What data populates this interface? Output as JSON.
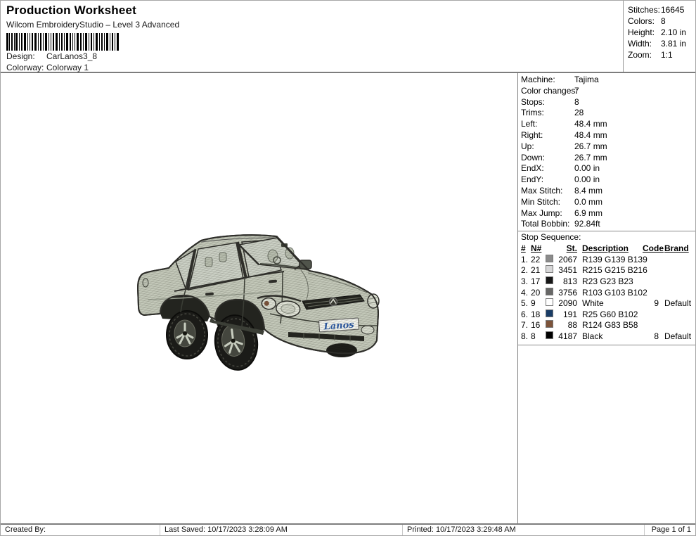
{
  "header": {
    "title": "Production Worksheet",
    "subtitle": "Wilcom EmbroideryStudio – Level 3 Advanced",
    "design_label": "Design:",
    "design_value": "CarLanos3_8",
    "colorway_label": "Colorway:",
    "colorway_value": "Colorway 1"
  },
  "stats": {
    "rows": [
      {
        "label": "Stitches:",
        "value": "16645"
      },
      {
        "label": "Colors:",
        "value": "8"
      },
      {
        "label": "Height:",
        "value": "2.10 in"
      },
      {
        "label": "Width:",
        "value": "3.81 in"
      },
      {
        "label": "Zoom:",
        "value": "1:1"
      }
    ]
  },
  "machine": {
    "rows": [
      {
        "label": "Machine:",
        "value": "Tajima"
      },
      {
        "label": "Color changes:",
        "value": "7"
      },
      {
        "label": "Stops:",
        "value": "8"
      },
      {
        "label": "Trims:",
        "value": "28"
      },
      {
        "label": "Left:",
        "value": "48.4 mm"
      },
      {
        "label": "Right:",
        "value": "48.4 mm"
      },
      {
        "label": "Up:",
        "value": "26.7 mm"
      },
      {
        "label": "Down:",
        "value": "26.7 mm"
      },
      {
        "label": "EndX:",
        "value": "0.00 in"
      },
      {
        "label": "EndY:",
        "value": "0.00 in"
      },
      {
        "label": "Max Stitch:",
        "value": "8.4 mm"
      },
      {
        "label": "Min Stitch:",
        "value": "0.0 mm"
      },
      {
        "label": "Max Jump:",
        "value": "6.9 mm"
      },
      {
        "label": "Total Bobbin:",
        "value": "92.84ft"
      }
    ]
  },
  "stop_sequence": {
    "section_label": "Stop Sequence:",
    "headers": {
      "num": "#",
      "n": "N#",
      "st": "St.",
      "desc": "Description",
      "code": "Code",
      "brand": "Brand"
    },
    "rows": [
      {
        "num": "1.",
        "n": "22",
        "color": "#8b8b8b",
        "st": "2067",
        "desc": "R139 G139 B139",
        "code": "",
        "brand": ""
      },
      {
        "num": "2.",
        "n": "21",
        "color": "#d7d7d8",
        "st": "3451",
        "desc": "R215 G215 B216",
        "code": "",
        "brand": ""
      },
      {
        "num": "3.",
        "n": "17",
        "color": "#171717",
        "st": "813",
        "desc": "R23 G23 B23",
        "code": "",
        "brand": ""
      },
      {
        "num": "4.",
        "n": "20",
        "color": "#676766",
        "st": "3756",
        "desc": "R103 G103 B102",
        "code": "",
        "brand": ""
      },
      {
        "num": "5.",
        "n": "9",
        "color": "#ffffff",
        "st": "2090",
        "desc": "White",
        "code": "9",
        "brand": "Default"
      },
      {
        "num": "6.",
        "n": "18",
        "color": "#193c66",
        "st": "191",
        "desc": "R25 G60 B102",
        "code": "",
        "brand": ""
      },
      {
        "num": "7.",
        "n": "16",
        "color": "#7c533a",
        "st": "88",
        "desc": "R124 G83 B58",
        "code": "",
        "brand": ""
      },
      {
        "num": "8.",
        "n": "8",
        "color": "#000000",
        "st": "4187",
        "desc": "Black",
        "code": "8",
        "brand": "Default"
      }
    ]
  },
  "design_preview": {
    "artwork": "car-lanos-embroidery",
    "plate_text": "Lanos",
    "colors": {
      "body": "#c5cabb",
      "glass": "#cdd2c7",
      "outline": "#2e2e2a",
      "tire": "#1b1b18",
      "plate_blue": "#2b5aa6"
    }
  },
  "footer": {
    "created_by": "Created By:",
    "last_saved": "Last Saved: 10/17/2023 3:28:09 AM",
    "printed": "Printed: 10/17/2023 3:29:48 AM",
    "page": "Page 1 of 1"
  }
}
